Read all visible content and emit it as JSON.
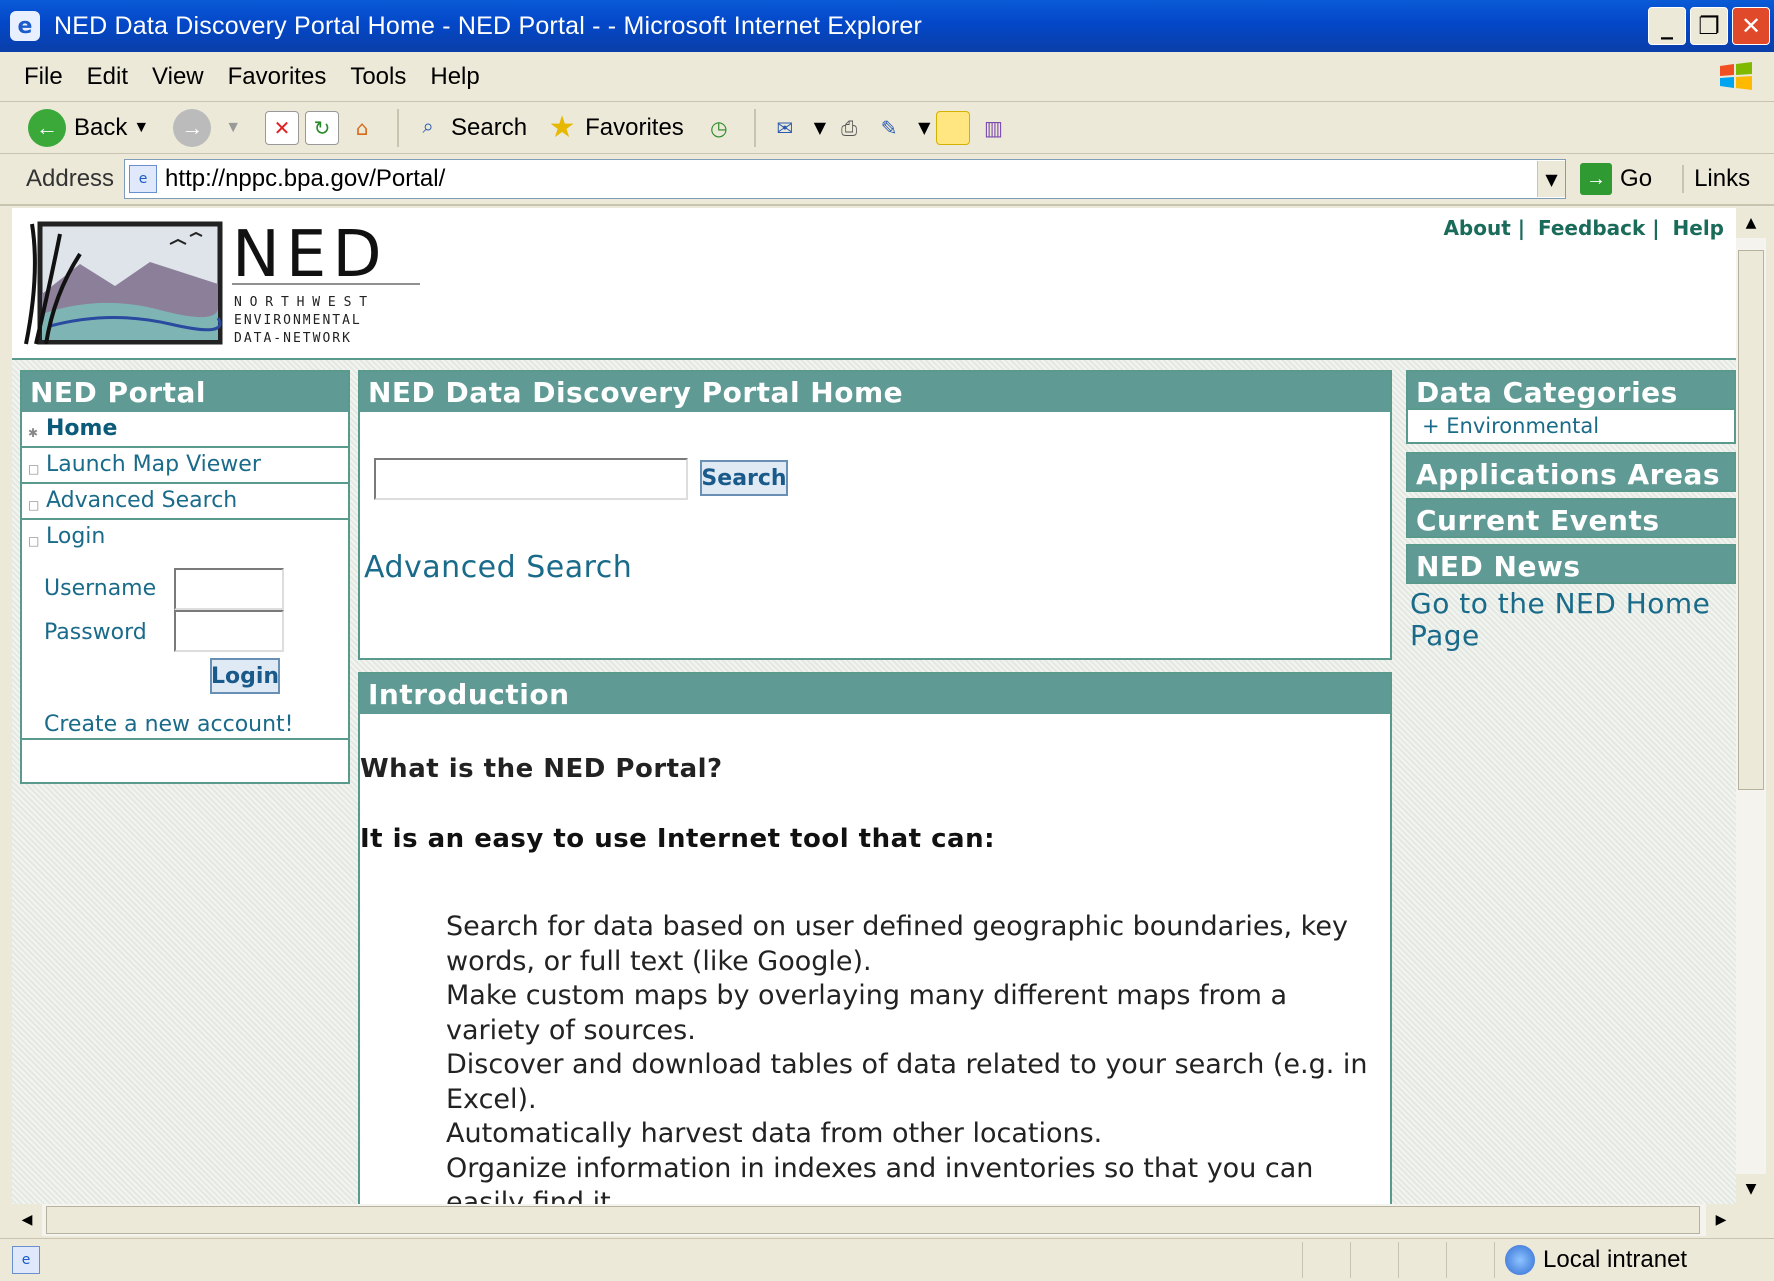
{
  "window": {
    "title": "NED Data Discovery Portal Home - NED Portal - - Microsoft Internet Explorer"
  },
  "menu": [
    "File",
    "Edit",
    "View",
    "Favorites",
    "Tools",
    "Help"
  ],
  "toolbar": {
    "back": "Back",
    "search": "Search",
    "favorites": "Favorites"
  },
  "address": {
    "label": "Address",
    "url": "http://nppc.bpa.gov/Portal/",
    "go": "Go",
    "links": "Links"
  },
  "header": {
    "logo_title": "NED",
    "logo_line1": "N O R T H W E S T",
    "logo_line2": "ENVIRONMENTAL",
    "logo_line3": "DATA-NETWORK",
    "links": [
      "About",
      "Feedback",
      "Help"
    ]
  },
  "left": {
    "title": "NED Portal",
    "items": [
      "Home",
      "Launch Map Viewer",
      "Advanced Search",
      "Login"
    ],
    "username": "Username",
    "password": "Password",
    "login_button": "Login",
    "create": "Create a new account!"
  },
  "center": {
    "title": "NED Data Discovery Portal Home",
    "search_button": "Search",
    "advanced": "Advanced Search",
    "intro_title": "Introduction",
    "q": "What is the NED Portal?",
    "lead": "It is an easy to use Internet tool that can:",
    "bullets": [
      "Search for data based on user defined geographic boundaries, key words, or full text (like Google).",
      "Make custom maps by overlaying many different maps from a variety of sources.",
      "Discover and download tables of data related to your search (e.g. in Excel).",
      "Automatically harvest data from other locations.",
      "Organize information in indexes and inventories so that you can easily find it."
    ]
  },
  "right": {
    "data_categories": "Data Categories",
    "environmental": "Environmental",
    "applications": "Applications Areas",
    "events": "Current Events",
    "news": "NED News",
    "home_link": "Go to the NED Home Page"
  },
  "status": {
    "zone": "Local intranet"
  }
}
